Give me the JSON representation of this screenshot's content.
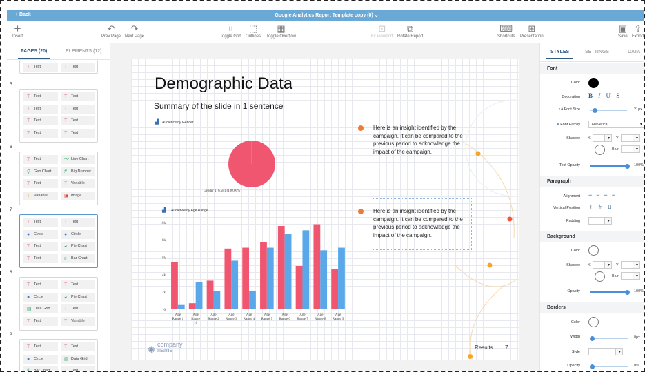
{
  "topbar": {
    "back": "+ Back",
    "title": "Google Analytics Report Template copy (0) ⌄"
  },
  "toolbar": {
    "insert": "Insert",
    "prev": "Prev Page",
    "next": "Next Page",
    "grid": "Toggle Grid",
    "outlines": "Outlines",
    "overflow": "Toggle Overflow",
    "fit": "Fit Viewport",
    "rotate": "Rotate Report",
    "shortcuts": "Shortcuts",
    "presentation": "Presentation",
    "save": "Save",
    "export": "Export"
  },
  "left": {
    "tab_pages": "PAGES (20)",
    "tab_elements": "ELEMENTS (12)",
    "pages": [
      {
        "num": "",
        "chips": [
          "Text",
          "Text"
        ]
      },
      {
        "num": "5",
        "chips": [
          "Text",
          "Text",
          "Text",
          "Text",
          "Text",
          "Text",
          "Text",
          "Text"
        ]
      },
      {
        "num": "6",
        "chips": [
          "Text",
          "Line Chart",
          "Geo Chart",
          "Big Number",
          "Text",
          "Variable",
          "Variable",
          "Image"
        ]
      },
      {
        "num": "7",
        "chips": [
          "Text",
          "Text",
          "Circle",
          "Circle",
          "Text",
          "Pie Chart",
          "Text",
          "Bar Chart"
        ]
      },
      {
        "num": "8",
        "chips": [
          "Text",
          "Text",
          "Circle",
          "Pie Chart",
          "Data Grid",
          "Text",
          "Text",
          "Variable"
        ]
      },
      {
        "num": "9",
        "chips": [
          "Text",
          "Text",
          "Circle",
          "Data Grid",
          "Bar Chart",
          "Text"
        ]
      }
    ]
  },
  "slide": {
    "title": "Demographic Data",
    "subtitle": "Summary of the slide in 1 sentence",
    "pie_title": "Audience by Gender",
    "pie_label": "Gender 1: 6,581 (100.00%)",
    "bar_title": "Audience by Age Range",
    "insight1": "Here is an insight identified by the campaign. It can be compared to the previous period to acknowledge the impact of the campaign.",
    "insight2": "Here is an insight identified by the campaign. It can be compared to the previous period to acknowledge the impact of the campaign.",
    "logo_top": "company",
    "logo_bottom": "name",
    "footer_label": "Results",
    "page_number": "7"
  },
  "chart_data": [
    {
      "type": "pie",
      "title": "Audience by Gender",
      "categories": [
        "Gender 1"
      ],
      "values": [
        6581
      ],
      "labels": [
        "Gender 1: 6,581 (100.00%)"
      ],
      "colors": [
        "#f0566f"
      ]
    },
    {
      "type": "bar",
      "title": "Audience by Age Range",
      "categories": [
        "Age Range 1",
        "Age Range 10",
        "Age Range 2",
        "Age Range 3",
        "Age Range 4",
        "Age Range 5",
        "Age Range 6",
        "Age Range 7",
        "Age Range 8",
        "Age Range 9"
      ],
      "tick_labels": [
        [
          "Age",
          "Range 1"
        ],
        [
          "Age",
          "Range",
          "10"
        ],
        [
          "Age",
          "Range 2"
        ],
        [
          "Age",
          "Range 3"
        ],
        [
          "Age",
          "Range 4"
        ],
        [
          "Age",
          "Range 5"
        ],
        [
          "Age",
          "Range 6"
        ],
        [
          "Age",
          "Range 7"
        ],
        [
          "Age",
          "Range 8"
        ],
        [
          "Age",
          "Range 9"
        ]
      ],
      "series": [
        {
          "values": [
            5400,
            700,
            3300,
            7000,
            7100,
            7700,
            9600,
            5000,
            9800,
            4600
          ],
          "color": "#f0566f"
        },
        {
          "values": [
            500,
            3100,
            2100,
            5600,
            2100,
            7100,
            8700,
            9100,
            6800,
            7100
          ],
          "color": "#5aa8ea"
        }
      ],
      "ylim": [
        0,
        10000
      ],
      "yticks": [
        0,
        2000,
        4000,
        6000,
        8000,
        10000
      ],
      "ytick_labels": [
        "0",
        "2k",
        "4k",
        "6k",
        "8k",
        "10k"
      ],
      "grid": true
    }
  ],
  "right": {
    "tab_styles": "STYLES",
    "tab_settings": "SETTINGS",
    "tab_data": "DATA",
    "font_header": "Font",
    "color": "Color",
    "decoration": "Decoration",
    "decoration_icons": [
      "B",
      "I",
      "U",
      "S"
    ],
    "font_size": "Font Size",
    "font_size_value": "21px",
    "font_family": "Font Family",
    "font_family_value": "Helvetica",
    "shadow": "Shadow",
    "x": "X",
    "y": "Y",
    "blur": "Blur",
    "text_opacity": "Text Opacity",
    "text_opacity_value": "100%",
    "paragraph_header": "Paragraph",
    "alignment": "Alignment",
    "vertical_position": "Vertical Position",
    "padding": "Padding",
    "background_header": "Background",
    "opacity": "Opacity",
    "opacity_value": "100%",
    "borders_header": "Borders",
    "width": "Width",
    "width_value": "0px",
    "style": "Style",
    "borders_opacity_value": "0%",
    "font_color": "#000000",
    "accent": "#2e5c86",
    "top_color": "#6aa9d6"
  }
}
